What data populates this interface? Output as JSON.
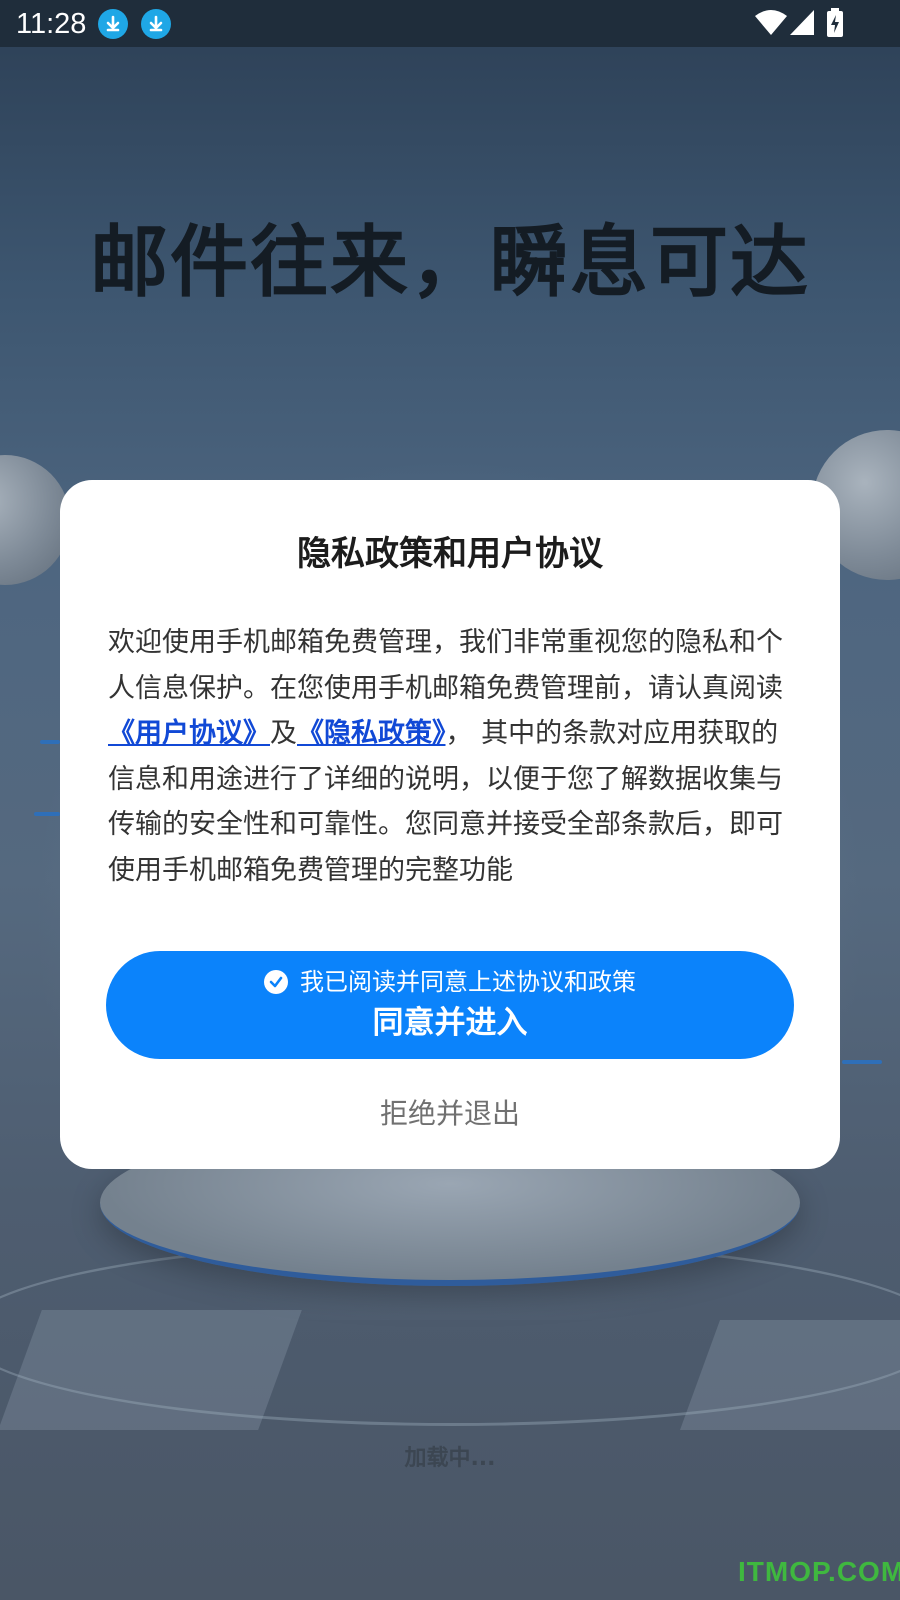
{
  "status_bar": {
    "time": "11:28",
    "icons": [
      "download-icon",
      "download-icon",
      "wifi-icon",
      "cellular-signal-icon",
      "battery-charging-icon"
    ]
  },
  "background": {
    "hero_title": "邮件往来，瞬息可达",
    "loading_text": "加载中..."
  },
  "dialog": {
    "title": "隐私政策和用户协议",
    "body_intro": "欢迎使用手机邮箱免费管理，我们非常重视您的隐私和个人信息保护。在您使用手机邮箱免费管理前，请认真阅读",
    "user_agreement_link": "《用户协议》",
    "and_text": "及",
    "privacy_policy_link": "《隐私政策》",
    "body_rest": "， 其中的条款对应用获取的信息和用途进行了详细的说明，以便于您了解数据收集与传输的安全性和可靠性。您同意并接受全部条款后，即可使用手机邮箱免费管理的完整功能",
    "consent_note": "我已阅读并同意上述协议和政策",
    "agree_button_label": "同意并进入",
    "reject_label": "拒绝并退出"
  },
  "watermark": "ITMOP.COM",
  "colors": {
    "primary_button": "#0b83fb",
    "link": "#1149d6",
    "status_bar_bg": "#1f2d3b",
    "download_icon_bg": "#1fa7e6",
    "watermark": "#3fb83f"
  }
}
